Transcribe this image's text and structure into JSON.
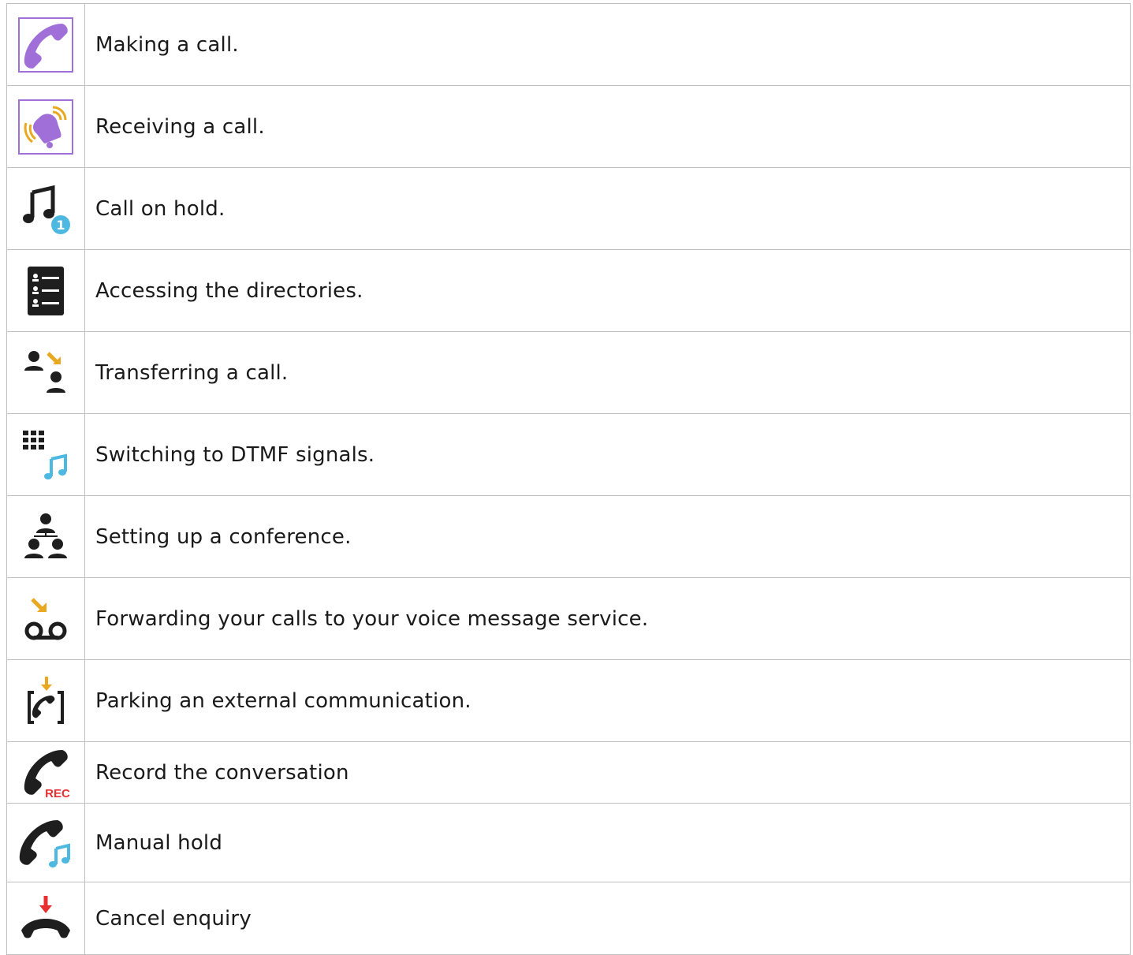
{
  "rows": [
    {
      "icon": "making-call-icon",
      "label": "Making a call."
    },
    {
      "icon": "receiving-call-icon",
      "label": "Receiving a call."
    },
    {
      "icon": "call-on-hold-icon",
      "label": "Call on hold."
    },
    {
      "icon": "directory-icon",
      "label": "Accessing the directories."
    },
    {
      "icon": "transfer-call-icon",
      "label": "Transferring a call."
    },
    {
      "icon": "dtmf-keypad-icon",
      "label": "Switching to DTMF signals."
    },
    {
      "icon": "conference-icon",
      "label": "Setting up a conference."
    },
    {
      "icon": "voicemail-forward-icon",
      "label": "Forwarding your calls to your voice message service."
    },
    {
      "icon": "park-call-icon",
      "label": "Parking an external communication."
    },
    {
      "icon": "record-call-icon",
      "label": "Record the conversation",
      "badge": "REC"
    },
    {
      "icon": "manual-hold-icon",
      "label": "Manual hold"
    },
    {
      "icon": "cancel-enquiry-icon",
      "label": "Cancel enquiry"
    }
  ],
  "colors": {
    "purple": "#a070d8",
    "gold": "#e8a820",
    "blue": "#4db8e0",
    "red": "#e83030",
    "dark": "#1e1e1e",
    "border": "#bfbfbf"
  }
}
